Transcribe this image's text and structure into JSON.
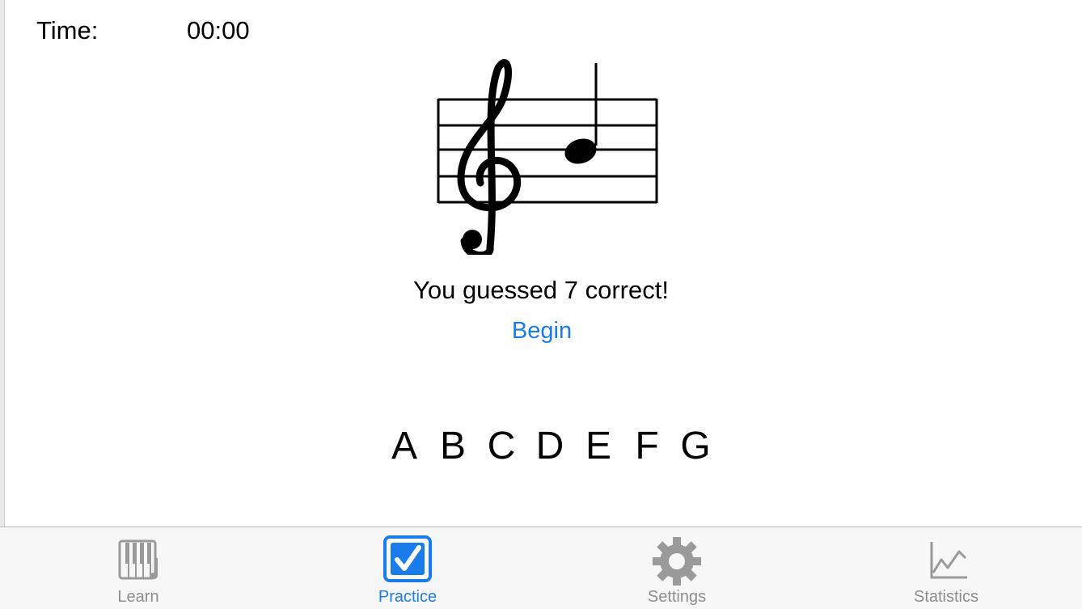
{
  "timer": {
    "label": "Time:",
    "value": "00:00"
  },
  "result": {
    "message": "You guessed 7 correct!"
  },
  "controls": {
    "begin_label": "Begin"
  },
  "answers": [
    "A",
    "B",
    "C",
    "D",
    "E",
    "F",
    "G"
  ],
  "tabs": [
    {
      "label": "Learn",
      "icon": "piano-keys-icon",
      "active": false
    },
    {
      "label": "Practice",
      "icon": "checkbox-icon",
      "active": true
    },
    {
      "label": "Settings",
      "icon": "gear-icon",
      "active": false
    },
    {
      "label": "Statistics",
      "icon": "line-chart-icon",
      "active": false
    }
  ],
  "colors": {
    "accent": "#1a7bea",
    "inactive": "#8e8e8e",
    "tabbar_bg": "#f7f7f7"
  }
}
